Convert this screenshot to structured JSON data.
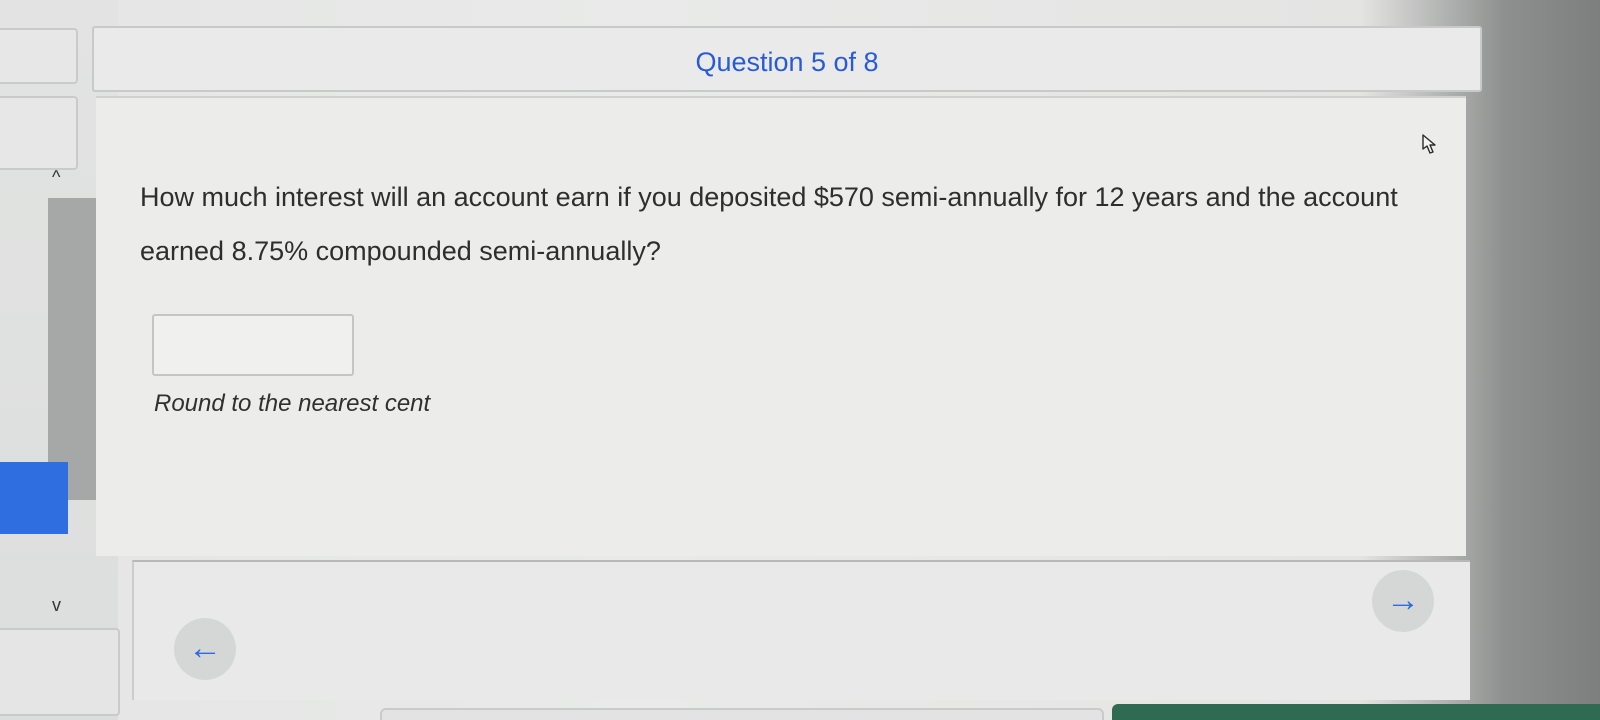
{
  "header": {
    "title": "Question 5 of 8"
  },
  "question": {
    "text": "How much interest will an account earn if you deposited $570 semi-annually for 12 years and the account earned 8.75% compounded semi-annually?"
  },
  "answer": {
    "value": "",
    "placeholder": ""
  },
  "hint": {
    "text": "Round to the nearest cent"
  },
  "navigation": {
    "previous_icon": "arrow-left-icon",
    "next_icon": "arrow-right-icon",
    "previous_glyph": "←",
    "next_glyph": "→"
  },
  "sidebar": {
    "scroll_up_glyph": "^",
    "scroll_down_glyph": "v"
  },
  "colors": {
    "accent_blue": "#2a5bd7",
    "panel_blue": "#2e6ee0",
    "submit_green": "#2f6b52"
  }
}
